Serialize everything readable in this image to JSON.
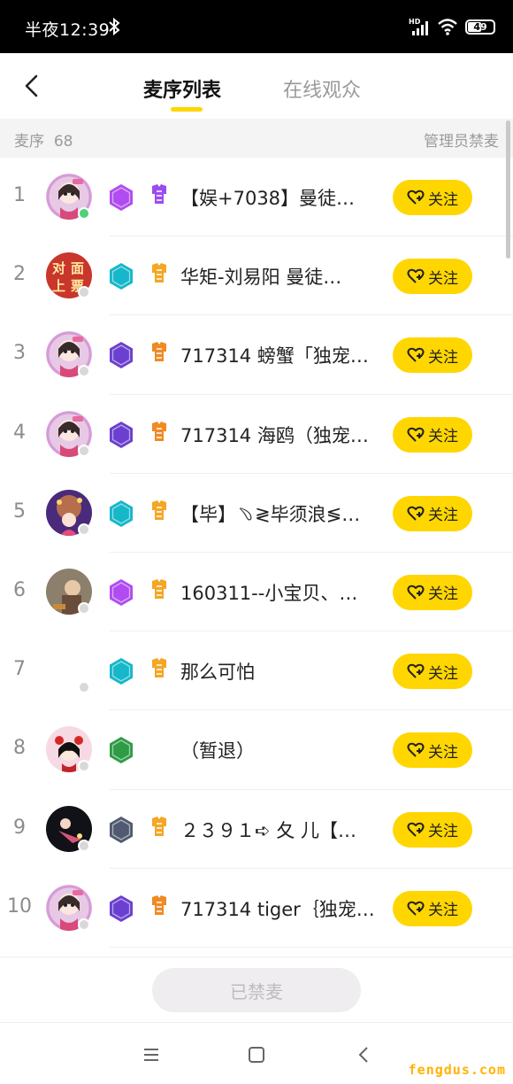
{
  "status_bar": {
    "time": "半夜12:39",
    "battery": "49",
    "network_label": "HD"
  },
  "header": {
    "tabs": [
      {
        "label": "麦序列表",
        "active": true
      },
      {
        "label": "在线观众",
        "active": false
      }
    ]
  },
  "subheader": {
    "label": "麦序",
    "count": "68",
    "action": "管理员禁麦"
  },
  "rows": [
    {
      "rank": "1",
      "level": "侯",
      "level_color": "#b04cf0",
      "role_color": "#9b4cf0",
      "name": "【娱+7038】曼徒…",
      "online": true,
      "follow": "关注",
      "avatar_color": "#e7c9e6"
    },
    {
      "rank": "2",
      "level": "子",
      "level_color": "#15b7c9",
      "role_color": "#f5a623",
      "name": "华矩-刘易阳  曼徒…",
      "online": false,
      "follow": "关注",
      "avatar_color": "#c9362c",
      "avatar_text": [
        "对",
        "面",
        "上",
        "票"
      ]
    },
    {
      "rank": "3",
      "level": "公",
      "level_color": "#6b3fcf",
      "role_color": "#f08a24",
      "name": "717314 螃蟹「独宠…",
      "online": false,
      "follow": "关注",
      "avatar_color": "#e7c9e6"
    },
    {
      "rank": "4",
      "level": "公",
      "level_color": "#6b3fcf",
      "role_color": "#f08a24",
      "name": "717314 海鸥（独宠…",
      "online": false,
      "follow": "关注",
      "avatar_color": "#e7c9e6"
    },
    {
      "rank": "5",
      "level": "子",
      "level_color": "#15b7c9",
      "role_color": "#f5a623",
      "name": "【毕】﹆≷毕须浪≶…",
      "online": false,
      "follow": "关注",
      "avatar_color": "#4a2a7a"
    },
    {
      "rank": "6",
      "level": "侯",
      "level_color": "#b04cf0",
      "role_color": "#f5a623",
      "name": "160311--小宝贝、…",
      "online": false,
      "follow": "关注",
      "avatar_color": "#8c7f6b"
    },
    {
      "rank": "7",
      "level": "子",
      "level_color": "#15b7c9",
      "role_color": "#f5a623",
      "name": "那么可怕",
      "online": false,
      "follow": "关注",
      "avatar_color": "#ffffff"
    },
    {
      "rank": "8",
      "level": "男",
      "level_color": "#2e9b45",
      "role_color": "",
      "name": "（暂退）",
      "online": false,
      "follow": "关注",
      "avatar_color": "#f7d9e3"
    },
    {
      "rank": "9",
      "level": "勋",
      "level_color": "#4f5a70",
      "role_color": "#f5a623",
      "name": "２３９１➪ 夂  儿【…",
      "online": false,
      "follow": "关注",
      "avatar_color": "#111118"
    },
    {
      "rank": "10",
      "level": "公",
      "level_color": "#6b3fcf",
      "role_color": "#f08a24",
      "name": "717314 tiger｛独宠…",
      "online": false,
      "follow": "关注",
      "avatar_color": "#e7c9e6"
    }
  ],
  "bottom": {
    "banned_label": "已禁麦"
  },
  "watermark": "fengdus.com"
}
